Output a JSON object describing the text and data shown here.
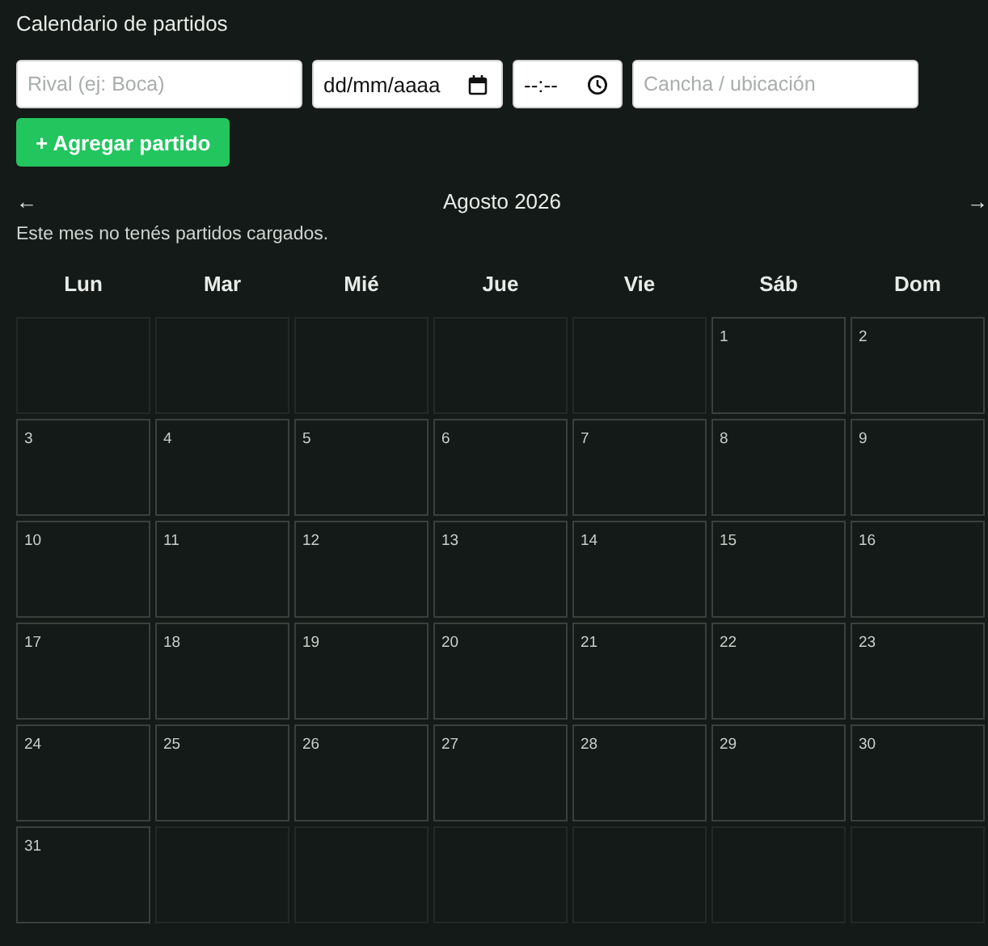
{
  "title": "Calendario de partidos",
  "form": {
    "fields": [
      {
        "kind": "text",
        "placeholder": "Rival (ej: Boca)"
      },
      {
        "kind": "date",
        "placeholder": "dd/mm/aaaa"
      },
      {
        "kind": "time",
        "placeholder": "--:--"
      },
      {
        "kind": "text",
        "placeholder": "Cancha / ubicación"
      }
    ],
    "add_button": "+ Agregar partido"
  },
  "nav": {
    "prev": "←",
    "month": "Agosto 2026",
    "next": "→"
  },
  "message": "Este mes no tenés partidos cargados.",
  "weekdays": [
    "Lun",
    "Mar",
    "Mié",
    "Jue",
    "Vie",
    "Sáb",
    "Dom"
  ],
  "cells": [
    {
      "kind": "blank"
    },
    {
      "kind": "blank"
    },
    {
      "kind": "blank"
    },
    {
      "kind": "blank"
    },
    {
      "kind": "blank"
    },
    {
      "kind": "day",
      "day": "1"
    },
    {
      "kind": "day",
      "day": "2"
    },
    {
      "kind": "day",
      "day": "3"
    },
    {
      "kind": "day",
      "day": "4"
    },
    {
      "kind": "day",
      "day": "5"
    },
    {
      "kind": "day",
      "day": "6"
    },
    {
      "kind": "day",
      "day": "7"
    },
    {
      "kind": "day",
      "day": "8"
    },
    {
      "kind": "day",
      "day": "9"
    },
    {
      "kind": "day",
      "day": "10"
    },
    {
      "kind": "day",
      "day": "11"
    },
    {
      "kind": "day",
      "day": "12"
    },
    {
      "kind": "day",
      "day": "13"
    },
    {
      "kind": "day",
      "day": "14"
    },
    {
      "kind": "day",
      "day": "15"
    },
    {
      "kind": "day",
      "day": "16"
    },
    {
      "kind": "day",
      "day": "17"
    },
    {
      "kind": "day",
      "day": "18"
    },
    {
      "kind": "day",
      "day": "19"
    },
    {
      "kind": "day",
      "day": "20"
    },
    {
      "kind": "day",
      "day": "21"
    },
    {
      "kind": "day",
      "day": "22"
    },
    {
      "kind": "day",
      "day": "23"
    },
    {
      "kind": "day",
      "day": "24"
    },
    {
      "kind": "day",
      "day": "25"
    },
    {
      "kind": "day",
      "day": "26"
    },
    {
      "kind": "day",
      "day": "27"
    },
    {
      "kind": "day",
      "day": "28"
    },
    {
      "kind": "day",
      "day": "29"
    },
    {
      "kind": "day",
      "day": "30"
    },
    {
      "kind": "day",
      "day": "31"
    },
    {
      "kind": "blank"
    },
    {
      "kind": "blank"
    },
    {
      "kind": "blank"
    },
    {
      "kind": "blank"
    },
    {
      "kind": "blank"
    },
    {
      "kind": "blank"
    }
  ]
}
